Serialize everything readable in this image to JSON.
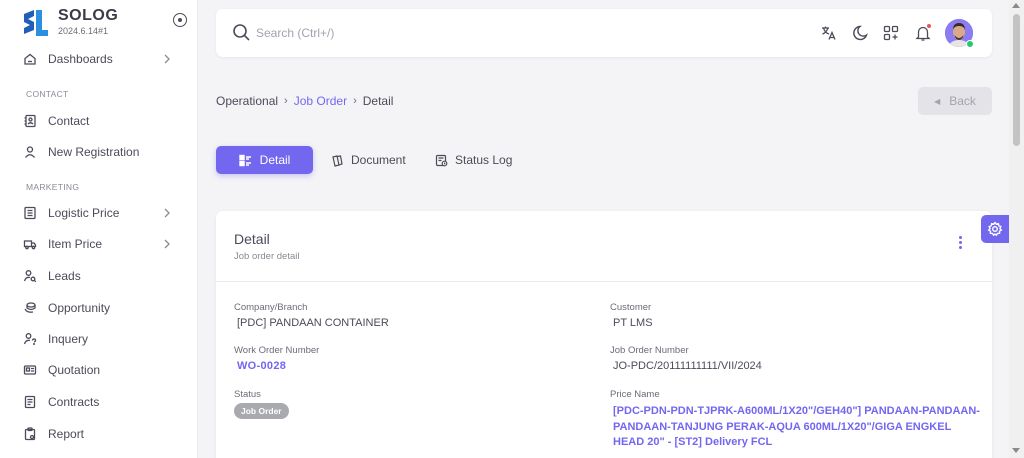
{
  "brand": {
    "name": "SOLOG",
    "version": "2024.6.14#1"
  },
  "sidebar": {
    "items": [
      {
        "label": "Dashboards",
        "icon": "home-icon",
        "has_submenu": true
      },
      {
        "label": "Contact",
        "icon": "contact-book-icon",
        "has_submenu": false
      },
      {
        "label": "New Registration",
        "icon": "user-icon",
        "has_submenu": false
      },
      {
        "label": "Logistic Price",
        "icon": "list-icon",
        "has_submenu": true
      },
      {
        "label": "Item Price",
        "icon": "truck-icon",
        "has_submenu": true
      },
      {
        "label": "Leads",
        "icon": "user-search-icon",
        "has_submenu": false
      },
      {
        "label": "Opportunity",
        "icon": "coins-icon",
        "has_submenu": false
      },
      {
        "label": "Inquery",
        "icon": "user-question-icon",
        "has_submenu": false
      },
      {
        "label": "Quotation",
        "icon": "id-card-icon",
        "has_submenu": false
      },
      {
        "label": "Contracts",
        "icon": "document-icon",
        "has_submenu": false
      },
      {
        "label": "Report",
        "icon": "clipboard-icon",
        "has_submenu": false
      }
    ],
    "sections": {
      "contact": "CONTACT",
      "marketing": "MARKETING"
    }
  },
  "search": {
    "placeholder": "Search (Ctrl+/)",
    "value": ""
  },
  "topbar_icons": [
    "translate-icon",
    "moon-icon",
    "grid-add-icon",
    "bell-icon"
  ],
  "breadcrumb": {
    "root": "Operational",
    "link": "Job Order",
    "current": "Detail",
    "separator": "›"
  },
  "back_button": {
    "label": "Back"
  },
  "tabs": [
    {
      "label": "Detail",
      "icon": "list-details-icon",
      "active": true
    },
    {
      "label": "Document",
      "icon": "documents-icon",
      "active": false
    },
    {
      "label": "Status Log",
      "icon": "status-log-icon",
      "active": false
    }
  ],
  "card": {
    "title": "Detail",
    "subtitle": "Job order detail",
    "fields": {
      "company_branch": {
        "label": "Company/Branch",
        "value": "[PDC] PANDAAN CONTAINER"
      },
      "customer": {
        "label": "Customer",
        "value": "PT LMS"
      },
      "work_order_number": {
        "label": "Work Order Number",
        "value": "WO-0028"
      },
      "job_order_number": {
        "label": "Job Order Number",
        "value": "JO-PDC/20111111111/VII/2024"
      },
      "status": {
        "label": "Status",
        "value": "Job Order"
      },
      "price_name": {
        "label": "Price Name",
        "value": "[PDC-PDN-PDN-TJPRK-A600ML/1X20\"/GEH40\"] PANDAAN-PANDAAN-PANDAAN-TANJUNG PERAK-AQUA 600ML/1X20\"/GIGA ENGKEL HEAD 20\" - [ST2] Delivery FCL"
      }
    }
  },
  "colors": {
    "primary": "#7367f0",
    "badge_gray": "#a8aab0",
    "notification": "#ea5455",
    "online": "#28c76f"
  }
}
